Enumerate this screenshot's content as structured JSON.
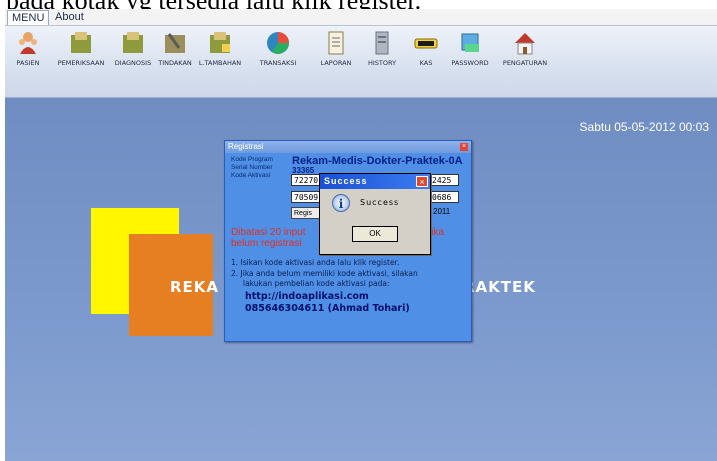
{
  "caption": "pada kotak yg tersedia lalu klik register.",
  "menubar": {
    "tabs": [
      "MENU",
      "About"
    ]
  },
  "toolbar": {
    "items": [
      {
        "label": "PASIEN",
        "icon": "patients-icon"
      },
      {
        "label": "PEMERIKSAAN",
        "icon": "examination-folder-icon"
      },
      {
        "label": "DIAGNOSIS",
        "icon": "diagnosis-folder-icon"
      },
      {
        "label": "TINDAKAN",
        "icon": "action-folder-icon"
      },
      {
        "label": "L.TAMBAHAN",
        "icon": "additional-folder-icon"
      },
      {
        "label": "TRANSAKSI",
        "icon": "transaction-chart-icon"
      },
      {
        "label": "LAPORAN",
        "icon": "report-icon"
      },
      {
        "label": "HISTORY",
        "icon": "history-icon"
      },
      {
        "label": "KAS",
        "icon": "cash-icon"
      },
      {
        "label": "PASSWORD",
        "icon": "password-icon"
      },
      {
        "label": "PENGATURAN",
        "icon": "settings-home-icon"
      }
    ]
  },
  "datetime": "Sabtu  05-05-2012  00:03",
  "brand": {
    "left": "REKA",
    "right": "RAKTEK"
  },
  "registrasi": {
    "title": "Registrasi",
    "kode_program_label": "Kode Program",
    "serial_number_label": "Serial Number",
    "kode_aktivasi_label": "Kode Aktivasi",
    "program_name": "Rekam-Medis-Dokter-Praktek-0A",
    "serial_number": "33365",
    "code_row1_left": "72270",
    "code_row1_right": "2425",
    "code_row2_left": "70509",
    "code_row2_right": "0686",
    "register_button": "Regis",
    "year": "2011",
    "warning_left": "Dibatasi 20 input",
    "warning_right": "jika",
    "warning_line2": "belum registrasi",
    "instruction1": "1. Isikan kode aktivasi anda lalu klik register.",
    "instruction2": "2. Jika anda belum memiliki kode aktivasi, silakan",
    "instruction3": "lakukan pembelian kode aktivasi pada:",
    "website": "http://indoaplikasi.com",
    "contact": "085646304611 (Ahmad Tohari)"
  },
  "success_dialog": {
    "title": "Success",
    "message": "Success",
    "ok_button": "OK"
  }
}
